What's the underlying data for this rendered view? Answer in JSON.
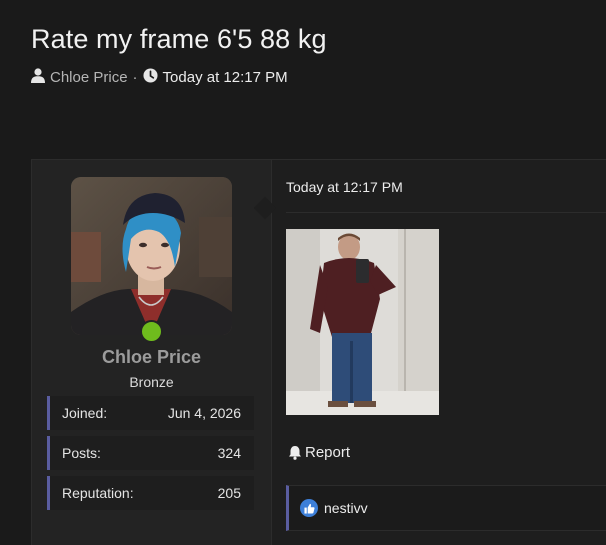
{
  "thread": {
    "title": "Rate my frame 6'5 88 kg",
    "author": "Chloe Price",
    "separator": "·",
    "time": "Today at 12:17 PM"
  },
  "user": {
    "name": "Chloe Price",
    "title": "Bronze",
    "stats": [
      {
        "label": "Joined:",
        "value": "Jun 4, 2026"
      },
      {
        "label": "Posts:",
        "value": "324"
      },
      {
        "label": "Reputation:",
        "value": "205"
      }
    ]
  },
  "post": {
    "date": "Today at 12:17 PM",
    "report_label": "Report",
    "reaction_user": "nestivv"
  },
  "colors": {
    "accent": "#5a5da0",
    "online": "#6fbb1d",
    "like": "#3d7fd8"
  },
  "icons": {
    "author": "user-icon",
    "time": "clock-icon",
    "report": "bell-icon",
    "reaction": "thumbs-up-icon"
  }
}
